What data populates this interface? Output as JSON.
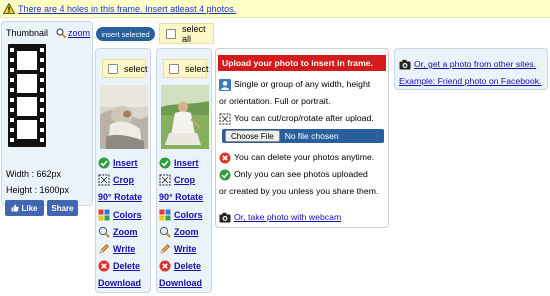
{
  "warning": {
    "text": "There are 4 holes in this frame. Insert atleast 4 photos."
  },
  "thumbnail": {
    "title": "Thumbnail",
    "zoom_label": "zoom",
    "width_text": "Width : 662px",
    "height_text": "Height : 1600px",
    "like_label": "Like",
    "share_label": "Share"
  },
  "toolbar": {
    "insert_selected_label": "insert selected",
    "select_all_label": "select all"
  },
  "slots": [
    {
      "select_label": "select",
      "actions": {
        "insert": "Insert",
        "crop": "Crop",
        "rotate": "90° Rotate",
        "colors": "Colors",
        "zoom": "Zoom",
        "write": "Write",
        "delete": "Delete",
        "download": "Download"
      }
    },
    {
      "select_label": "select",
      "actions": {
        "insert": "Insert",
        "crop": "Crop",
        "rotate": "90° Rotate",
        "colors": "Colors",
        "zoom": "Zoom",
        "write": "Write",
        "delete": "Delete",
        "download": "Download"
      }
    }
  ],
  "upload": {
    "header": "Upload your photo to insert in frame.",
    "line1": "Single or group of any width, height",
    "line2": "or orientation. Full or portrait.",
    "line3": "You can cut/crop/rotate after upload.",
    "choose_file_label": "Choose File",
    "no_file_text": "No file chosen",
    "line4": "You can delete your photos anytime.",
    "line5": "Only you can see photos uploaded",
    "line6": "or created by you unless you share them.",
    "webcam_link": "Or, take photo with webcam"
  },
  "other_sources": {
    "link1": "Or, get a photo from other sites.",
    "link2": "Example: Friend photo on Facebook."
  },
  "colors": {
    "brand_blue": "#2a5f9e",
    "facebook_blue": "#4267b2",
    "header_red": "#d41b1b",
    "warning_bg": "#ffffc6",
    "panel_bg": "#eaf2fa",
    "select_bg": "#fff7c7"
  }
}
